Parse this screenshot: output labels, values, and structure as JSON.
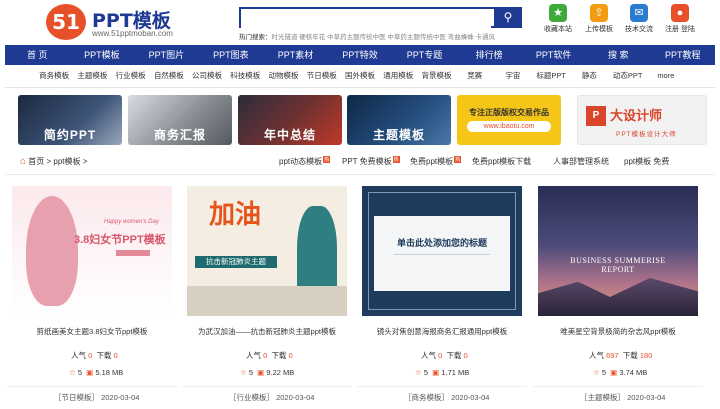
{
  "logo": {
    "badge": "51",
    "title": "PPT模板",
    "url": "www.51pptmoban.com"
  },
  "search": {
    "placeholder": "",
    "hot_label": "热门搜索：",
    "hot_terms": "时光隧道 硬核年花 中草药主题传统中医 中草药主题传统中医 弯曲蜂蛛 卡通风"
  },
  "quick_links": [
    {
      "label": "收藏本站",
      "icon": "star-icon",
      "color": "#3daa3a"
    },
    {
      "label": "上传模板",
      "icon": "upload-icon",
      "color": "#f39c12"
    },
    {
      "label": "技术交流",
      "icon": "chat-icon",
      "color": "#2b7bd1"
    },
    {
      "label": "注册 登陆",
      "icon": "user-icon",
      "color": "#e8502a"
    }
  ],
  "nav": [
    "首 页",
    "PPT模板",
    "PPT图片",
    "PPT图表",
    "PPT素材",
    "PPT特效",
    "PPT专题",
    "排行榜",
    "PPT软件",
    "搜 索",
    "PPT教程"
  ],
  "subnav": [
    "商务模板",
    "主题模板",
    "行业模板",
    "自然模板",
    "公司模板",
    "科技模板",
    "动物模板",
    "节日模板",
    "国外模板",
    "通用模板",
    "背景模板",
    "竞赛",
    "宇宙",
    "标题PPT",
    "静态",
    "动态PPT",
    "more"
  ],
  "banners": [
    {
      "label": "简约PPT",
      "color": "#2b3a55"
    },
    {
      "label": "商务汇报",
      "color": "#6a6e74"
    },
    {
      "label": "年中总结",
      "color": "#b83a2f"
    },
    {
      "label": "主题模板",
      "color": "#1d3f6e"
    },
    {
      "label": "专注正版版权交易作品",
      "sub": "www.ibaotu.com",
      "color": "#f5c518"
    },
    {
      "label": "大设计师",
      "sub": "PPT模板设计大师",
      "color": "#f2f2f2"
    }
  ],
  "breadcrumb": "首页 > ppt模板 >",
  "right_links": [
    "ppt动态模板",
    "PPT 免费模板",
    "免费ppt模板",
    "免费ppt模板下载",
    "人事部管理系统",
    "ppt模板 免费"
  ],
  "cards": [
    {
      "title": "剪纸画美女主题3.8妇女节ppt模板",
      "views_label": "人气",
      "views": "0",
      "downloads_label": "下载",
      "downloads": "0",
      "rating": "5",
      "size": "5.18 MB",
      "category": "［节日模板］",
      "date": "2020-03-04",
      "thumb_text": "3.8妇女节PPT模板",
      "thumb_sub": "Happy women's Day"
    },
    {
      "title": "为武汉加油——抗击新冠肺炎主题ppt模板",
      "views_label": "人气",
      "views": "0",
      "downloads_label": "下载",
      "downloads": "0",
      "rating": "5",
      "size": "9.22 MB",
      "category": "［行业模板］",
      "date": "2020-03-04",
      "thumb_text": "抗击新冠肺炎主题",
      "thumb_big": "加油"
    },
    {
      "title": "镜头对焦创意海报商务汇报通用ppt模板",
      "views_label": "人气",
      "views": "0",
      "downloads_label": "下载",
      "downloads": "0",
      "rating": "5",
      "size": "1.71 MB",
      "category": "［商务模板］",
      "date": "2020-03-04",
      "thumb_text": "单击此处添加您的标题"
    },
    {
      "title": "唯美星空背景极简的杂志风ppt模板",
      "views_label": "人气",
      "views": "697",
      "downloads_label": "下载",
      "downloads": "180",
      "rating": "5",
      "size": "3.74 MB",
      "category": "［主题模板］",
      "date": "2020-03-04",
      "thumb_text": "BUSINESS SUMMERISE REPORT"
    }
  ]
}
